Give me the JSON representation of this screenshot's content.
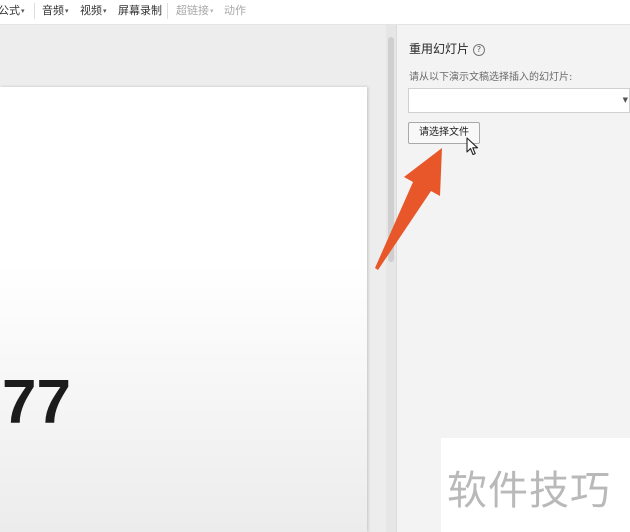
{
  "toolbar": {
    "items": [
      {
        "label": "公式",
        "dropdown": true,
        "enabled": true
      },
      {
        "label": "音频",
        "dropdown": true,
        "enabled": true
      },
      {
        "label": "视频",
        "dropdown": true,
        "enabled": true
      },
      {
        "label": "屏幕录制",
        "dropdown": false,
        "enabled": true
      },
      {
        "label": "超链接",
        "dropdown": true,
        "enabled": false
      },
      {
        "label": "动作",
        "dropdown": false,
        "enabled": false
      }
    ]
  },
  "slide": {
    "text": "77"
  },
  "reuse_panel": {
    "title": "重用幻灯片",
    "prompt": "请从以下演示文稿选择插入的幻灯片:",
    "file_select_value": "",
    "choose_file_button": "请选择文件"
  },
  "icons": {
    "help": "question-circle-icon",
    "dropdown": "triangle-down-icon",
    "cursor": "mouse-pointer-icon",
    "annotation": "orange-arrow"
  },
  "colors": {
    "annotation_arrow": "#e8572a"
  },
  "watermark": "软件技巧"
}
